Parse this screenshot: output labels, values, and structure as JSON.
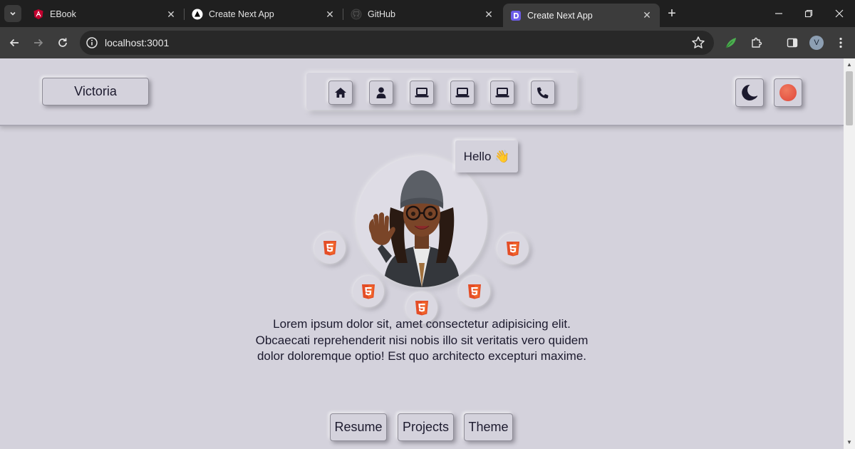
{
  "browser": {
    "tabs": [
      {
        "title": "EBook",
        "icon": "angular-icon",
        "active": false
      },
      {
        "title": "Create Next App",
        "icon": "nextjs-icon",
        "active": false
      },
      {
        "title": "GitHub",
        "icon": "github-icon",
        "active": false
      },
      {
        "title": "Create Next App",
        "icon": "next-dev-icon",
        "active": true
      }
    ],
    "url": "localhost:3001",
    "profile_initial": "V"
  },
  "header": {
    "brand": "Victoria",
    "nav_icons": [
      "home-icon",
      "user-icon",
      "laptop-icon",
      "laptop-icon",
      "laptop-icon",
      "phone-icon"
    ],
    "theme_icon": "moon-icon",
    "accent_color": "#e4533f"
  },
  "hero": {
    "greeting": "Hello 👋",
    "skill_icon": "html5-icon",
    "bio": "Lorem ipsum dolor sit, amet consectetur adipisicing elit. Obcaecati reprehenderit nisi nobis illo sit veritatis vero quidem dolor doloremque optio! Est quo architecto excepturi maxime."
  },
  "actions": {
    "resume": "Resume",
    "projects": "Projects",
    "theme": "Theme"
  },
  "colors": {
    "page_bg": "#d4d2dc",
    "text": "#1c1a2e",
    "html5": "#e44d26"
  }
}
